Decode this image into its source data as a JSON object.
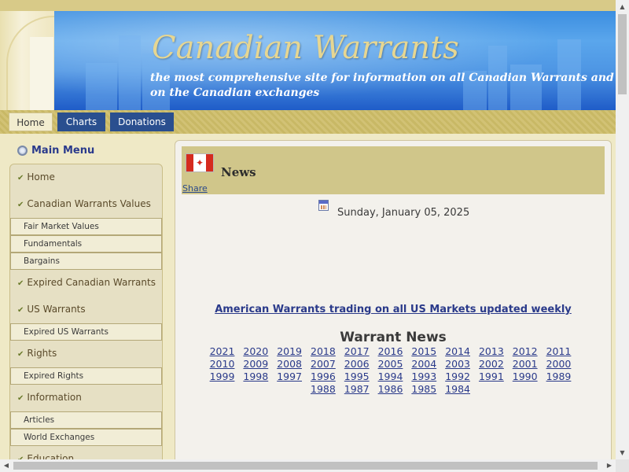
{
  "banner": {
    "title": "Canadian Warrants",
    "subtitle_line1": "the most comprehensive site for information on all Canadian Warrants and Rights past and pr",
    "subtitle_line2": "on the Canadian exchanges"
  },
  "nav": {
    "tabs": [
      {
        "label": "Home"
      },
      {
        "label": "Charts"
      },
      {
        "label": "Donations"
      }
    ]
  },
  "sidebar": {
    "title": "Main Menu",
    "items": [
      {
        "label": "Home"
      },
      {
        "label": "Canadian Warrants Values"
      },
      {
        "label": "Fair Market Values"
      },
      {
        "label": "Fundamentals"
      },
      {
        "label": "Bargains"
      },
      {
        "label": "Expired Canadian Warrants"
      },
      {
        "label": "US Warrants"
      },
      {
        "label": "Expired US Warrants"
      },
      {
        "label": "Rights"
      },
      {
        "label": "Expired Rights"
      },
      {
        "label": "Information"
      },
      {
        "label": "Articles"
      },
      {
        "label": "World Exchanges"
      },
      {
        "label": "Education"
      }
    ]
  },
  "main": {
    "news_title": "News",
    "share_label": "Share",
    "date": "Sunday, January 05, 2025",
    "us_link": "American Warrants trading on all US Markets updated weekly",
    "warrant_news_title": "Warrant News",
    "years": [
      "2021",
      "2020",
      "2019",
      "2018",
      "2017",
      "2016",
      "2015",
      "2014",
      "2013",
      "2012",
      "2011",
      "2010",
      "2009",
      "2008",
      "2007",
      "2006",
      "2005",
      "2004",
      "2003",
      "2002",
      "2001",
      "2000",
      "1999",
      "1998",
      "1997",
      "1996",
      "1995",
      "1994",
      "1993",
      "1992",
      "1991",
      "1990",
      "1989",
      "1988",
      "1987",
      "1986",
      "1985",
      "1984"
    ]
  }
}
